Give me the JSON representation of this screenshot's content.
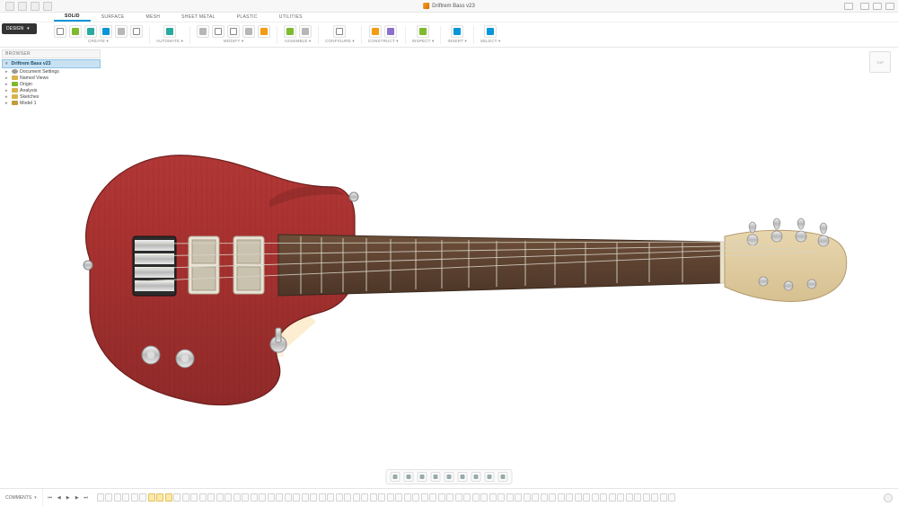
{
  "app": {
    "document_title": "Driftrem Bass v23",
    "workspace": "DESIGN"
  },
  "ribbon": {
    "tabs": [
      {
        "id": "solid",
        "label": "SOLID",
        "active": true
      },
      {
        "id": "surface",
        "label": "SURFACE",
        "active": false
      },
      {
        "id": "mesh",
        "label": "MESH",
        "active": false
      },
      {
        "id": "sheetmetal",
        "label": "SHEET METAL",
        "active": false
      },
      {
        "id": "plastic",
        "label": "PLASTIC",
        "active": false
      },
      {
        "id": "utilities",
        "label": "UTILITIES",
        "active": false
      }
    ],
    "groups": [
      {
        "id": "create",
        "label": "CREATE",
        "tools": [
          {
            "name": "new-design",
            "color": "g-box"
          },
          {
            "name": "sketch",
            "color": "g-green"
          },
          {
            "name": "extrude",
            "color": "g-teal"
          },
          {
            "name": "revolve",
            "color": "g-blue"
          },
          {
            "name": "hole",
            "color": "g-gray"
          },
          {
            "name": "box",
            "color": "g-box"
          }
        ]
      },
      {
        "id": "automate",
        "label": "AUTOMATE",
        "tools": [
          {
            "name": "script",
            "color": "g-teal"
          }
        ]
      },
      {
        "id": "modify",
        "label": "MODIFY",
        "tools": [
          {
            "name": "fillet",
            "color": "g-gray"
          },
          {
            "name": "press-pull",
            "color": "g-box"
          },
          {
            "name": "shell",
            "color": "g-box"
          },
          {
            "name": "combine",
            "color": "g-gray"
          },
          {
            "name": "appearance",
            "color": "g-orange"
          }
        ]
      },
      {
        "id": "assemble",
        "label": "ASSEMBLE",
        "tools": [
          {
            "name": "joint",
            "color": "g-green"
          },
          {
            "name": "rigid",
            "color": "g-gray"
          }
        ]
      },
      {
        "id": "configure",
        "label": "CONFIGURE",
        "tools": [
          {
            "name": "params",
            "color": "g-box"
          }
        ]
      },
      {
        "id": "construct",
        "label": "CONSTRUCT",
        "tools": [
          {
            "name": "plane",
            "color": "g-orange"
          },
          {
            "name": "axis",
            "color": "g-purple"
          }
        ]
      },
      {
        "id": "inspect",
        "label": "INSPECT",
        "tools": [
          {
            "name": "measure",
            "color": "g-green"
          }
        ]
      },
      {
        "id": "insert",
        "label": "INSERT",
        "tools": [
          {
            "name": "decal",
            "color": "g-blue"
          }
        ]
      },
      {
        "id": "select",
        "label": "SELECT",
        "tools": [
          {
            "name": "select-tool",
            "color": "g-blue"
          }
        ]
      }
    ]
  },
  "browser": {
    "header": "BROWSER",
    "root": "Driftrem Bass v23",
    "items": [
      {
        "label": "Document Settings",
        "icon": "gear"
      },
      {
        "label": "Named Views",
        "icon": "ico"
      },
      {
        "label": "Origin",
        "icon": "orig"
      },
      {
        "label": "Analysis",
        "icon": "ico"
      },
      {
        "label": "Sketches",
        "icon": "ico"
      },
      {
        "label": "Model 1",
        "icon": "cube"
      }
    ]
  },
  "viewcube": {
    "face": "TOP"
  },
  "navbar_tools": [
    {
      "name": "orbit"
    },
    {
      "name": "look"
    },
    {
      "name": "pan"
    },
    {
      "name": "zoom"
    },
    {
      "name": "fit"
    },
    {
      "name": "display"
    },
    {
      "name": "grid"
    },
    {
      "name": "snap"
    },
    {
      "name": "viewports"
    }
  ],
  "bottombar": {
    "comments_label": "COMMENTS",
    "timeline_count": 68,
    "marker_indices": [
      6,
      7,
      8
    ]
  },
  "model": {
    "description": "4-string electric bass guitar, offset body, red-stained wood, maple headstock, dark fretboard, chrome hardware"
  }
}
